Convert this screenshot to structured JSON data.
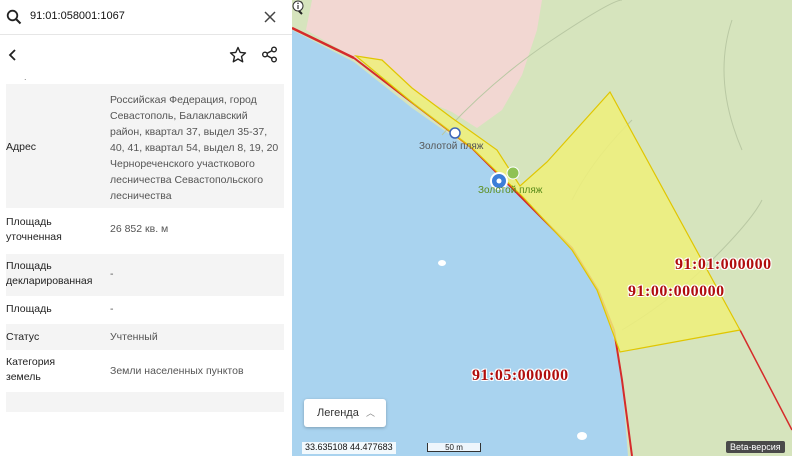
{
  "search": {
    "value": "91:01:058001:1067"
  },
  "attributes": [
    {
      "key": "Адрес",
      "value": "Российская Федерация, город Севастополь, Балаклавский район, квартал 37, выдел 35-37, 40, 41, квартал 54, выдел 8, 19, 20 Чернореченского участкового лесничества Севастопольского лесничества"
    },
    {
      "key": "Площадь уточненная",
      "value": "26 852 кв. м"
    },
    {
      "key": "Площадь декларированная",
      "value": "-"
    },
    {
      "key": "Площадь",
      "value": "-"
    },
    {
      "key": "Статус",
      "value": "Учтенный"
    },
    {
      "key": "Категория земель",
      "value": "Земли населенных пунктов"
    }
  ],
  "map": {
    "cadastral_labels": [
      "91:01:000000",
      "91:00:000000",
      "91:05:000000"
    ],
    "poi": [
      "Золотой пляж",
      "Золотой пляж"
    ],
    "legend_label": "Легенда",
    "coords": "33.635108  44.477683",
    "scale": "50 m",
    "beta": "Beta-версия"
  },
  "icons": [
    "search-icon",
    "close-icon",
    "back-icon",
    "star-icon",
    "share-icon",
    "info-icon",
    "chevron-up-icon"
  ]
}
